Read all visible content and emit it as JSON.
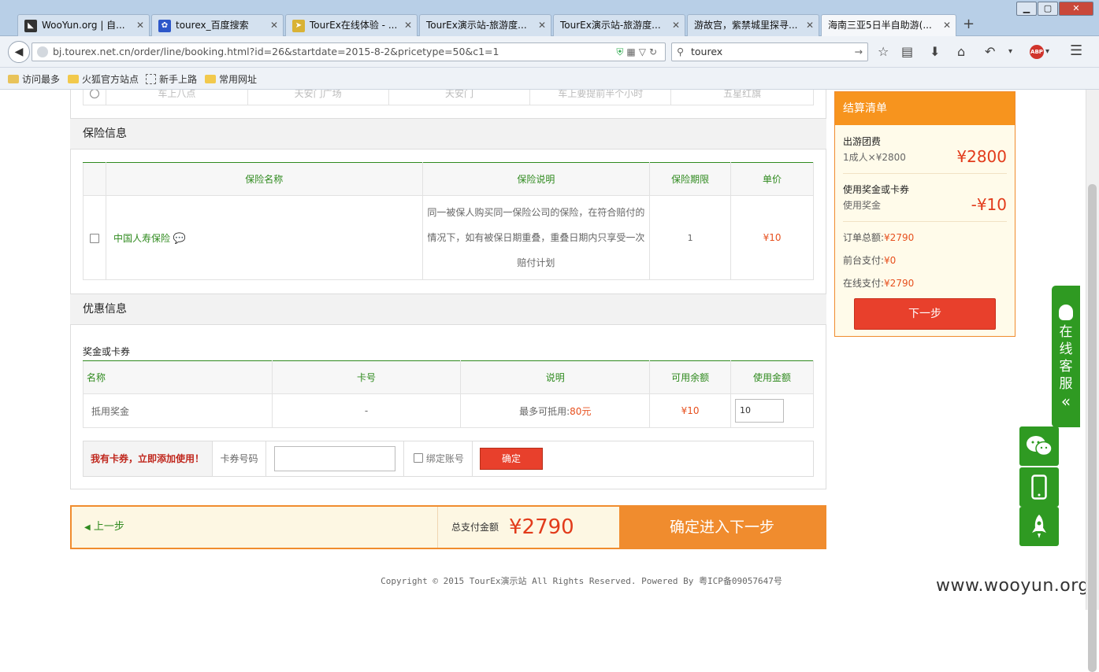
{
  "browser": {
    "tabs": [
      {
        "label": "WooYun.org | 自...",
        "icon": "wooyun-icon",
        "icon_color": "#333333"
      },
      {
        "label": "tourex_百度搜索",
        "icon": "baidu-paw-icon",
        "icon_color": "#2d57c9"
      },
      {
        "label": "TourEx在线体验 - ...",
        "icon": "tourex-icon",
        "icon_color": "#d9b235"
      },
      {
        "label": "TourEx演示站-旅游度...",
        "icon": "",
        "icon_color": ""
      },
      {
        "label": "TourEx演示站-旅游度...",
        "icon": "",
        "icon_color": ""
      },
      {
        "label": "游故宫，紫禁城里探寻...",
        "icon": "",
        "icon_color": ""
      },
      {
        "label": "海南三亚5日半自助游(...",
        "icon": "",
        "icon_color": "",
        "active": true
      }
    ],
    "new_tab": "+",
    "window_buttons": {
      "minimize": "▁",
      "maximize": "▢",
      "close": "✕"
    },
    "url": "bj.tourex.net.cn/order/line/booking.html?id=26&startdate=2015-8-2&pricetype=50&c1=1",
    "search_value": "tourex",
    "bookmarks": [
      "访问最多",
      "火狐官方站点",
      "新手上路",
      "常用网址"
    ]
  },
  "top_residue": [
    "车上八点",
    "天安门广场",
    "天安门",
    "车上要提前半个小时",
    "五星红旗"
  ],
  "insurance": {
    "section_title": "保险信息",
    "headers": [
      "保险名称",
      "保险说明",
      "保险期限",
      "单价"
    ],
    "rows": [
      {
        "name": "中国人寿保险",
        "desc_lines": [
          "同一被保人购买同一保险公司的保险，在符合赔付的",
          "情况下，如有被保日期重叠，重叠日期内只享受一次",
          "赔付计划"
        ],
        "term": "1",
        "price": "¥10"
      }
    ]
  },
  "discount": {
    "section_title": "优惠信息",
    "subtitle": "奖金或卡券",
    "headers": [
      "名称",
      "卡号",
      "说明",
      "可用余额",
      "使用金额"
    ],
    "rows": [
      {
        "name": "抵用奖金",
        "card_no": "-",
        "desc_prefix": "最多可抵用:",
        "desc_amount": "80元",
        "balance": "¥10",
        "use_amount": "10"
      }
    ],
    "card_prompt": "我有卡券，立即添加使用！",
    "card_no_label": "卡券号码",
    "bind_label": "绑定账号",
    "confirm": "确定"
  },
  "bottom_bar": {
    "prev": "上一步",
    "total_label": "总支付金额",
    "total_amount": "¥2790",
    "next": "确定进入下一步"
  },
  "copyright": "Copyright © 2015 TourEx演示站 All Rights Reserved. Powered By 粤ICP备09057647号",
  "watermark": "www.wooyun.org",
  "summary": {
    "title": "结算清单",
    "tour_fee_label": "出游团费",
    "tour_fee_detail": "1成人×¥2800",
    "tour_fee_amount": "¥2800",
    "bonus_label": "使用奖金或卡券",
    "bonus_detail": "使用奖金",
    "bonus_amount": "-¥10",
    "order_total_label": "订单总额:",
    "order_total": "¥2790",
    "front_pay_label": "前台支付:",
    "front_pay": "¥0",
    "online_pay_label": "在线支付:",
    "online_pay": "¥2790",
    "next": "下一步"
  },
  "service": {
    "online_label": [
      "在",
      "线",
      "客",
      "服"
    ],
    "collapse": "«"
  },
  "colors": {
    "accent_orange": "#f08c2e",
    "price_red": "#e23b1b",
    "brand_green": "#2f9a22"
  }
}
